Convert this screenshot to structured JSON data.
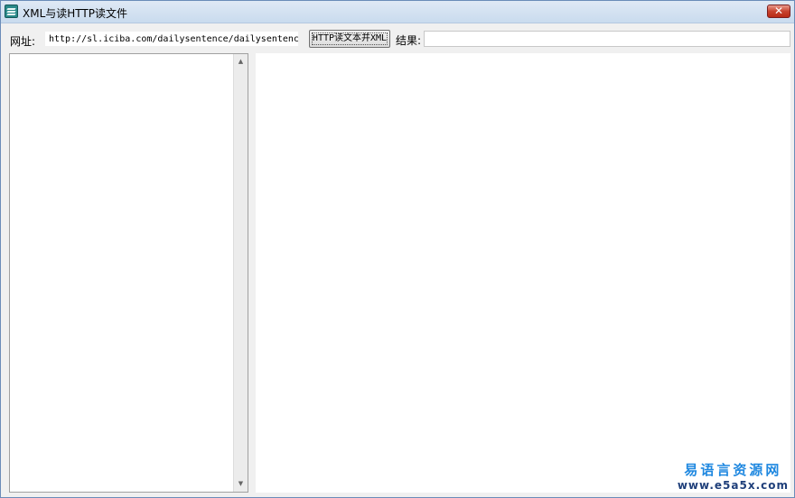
{
  "window": {
    "title": "XML与读HTTP读文件",
    "close_glyph": "✕"
  },
  "form": {
    "url_label": "网址:",
    "url_value": "http://sl.iciba.com/dailysentence/dailysentence.xml",
    "button_label": "HTTP读文本并XML",
    "result_label": "结果:",
    "result_value": ""
  },
  "scrollbar": {
    "up_glyph": "▲",
    "down_glyph": "▼"
  },
  "watermark": {
    "line1": "易语言资源网",
    "line2": "www.e5a5x.com"
  },
  "colors": {
    "title_bar": "#d5e3f3",
    "close_button": "#c8432e",
    "watermark_top": "#1f88e0",
    "watermark_bottom": "#1f3f7a"
  },
  "icons": {
    "app": "app-logo-icon",
    "close": "close-icon",
    "scroll_up": "scroll-up-arrow-icon",
    "scroll_down": "scroll-down-arrow-icon"
  }
}
